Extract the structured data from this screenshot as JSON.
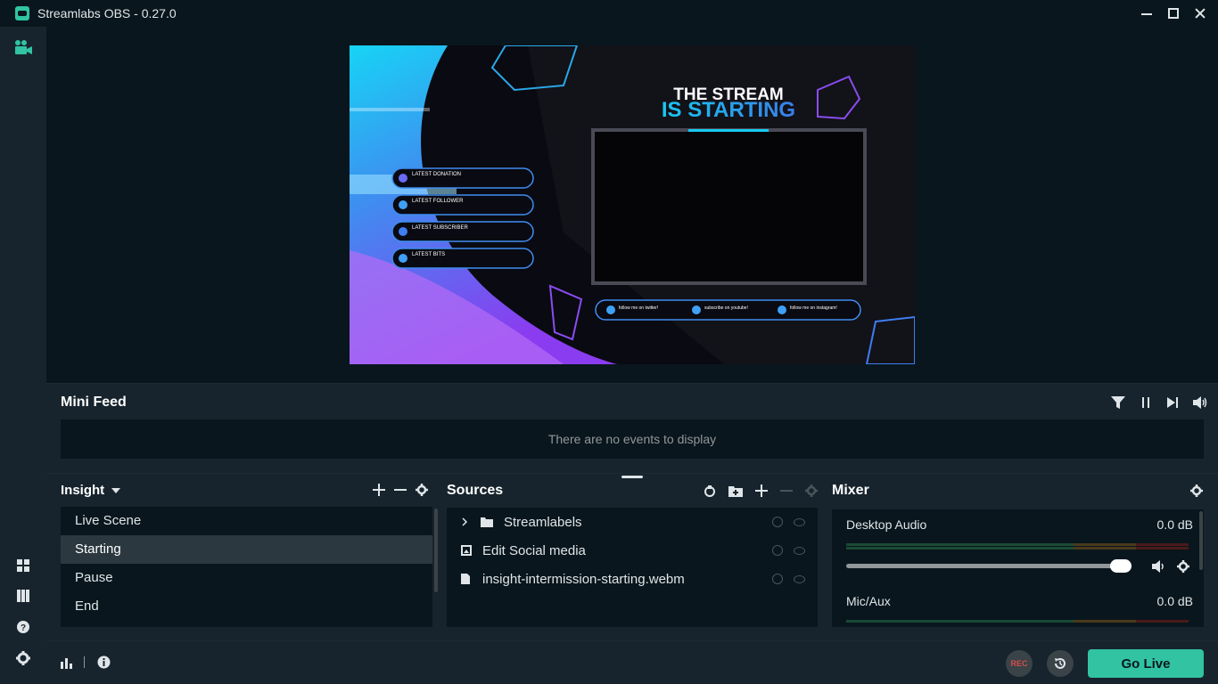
{
  "window": {
    "title": "Streamlabs OBS - 0.27.0"
  },
  "minifeed": {
    "title": "Mini Feed",
    "empty_text": "There are no events to display"
  },
  "scenes": {
    "collection": "Insight",
    "items": [
      "Live Scene",
      "Starting",
      "Pause",
      "End"
    ],
    "active": "Starting"
  },
  "sources": {
    "title": "Sources",
    "items": [
      {
        "name": "Streamlabels",
        "icon": "folder-icon",
        "expandable": true
      },
      {
        "name": "Edit Social media",
        "icon": "image-icon"
      },
      {
        "name": "insight-intermission-starting.webm",
        "icon": "file-icon"
      }
    ]
  },
  "mixer": {
    "title": "Mixer",
    "channels": [
      {
        "name": "Desktop Audio",
        "db": "0.0 dB",
        "volume": 1.0
      },
      {
        "name": "Mic/Aux",
        "db": "0.0 dB"
      }
    ]
  },
  "preview": {
    "heading_line1": "THE STREAM",
    "heading_line2": "IS STARTING",
    "labels": [
      "LATEST DONATION",
      "LATEST FOLLOWER",
      "LATEST SUBSCRIBER",
      "LATEST BITS"
    ],
    "socials": [
      "follow me on twitter!",
      "subscribe on youtube!",
      "follow me on instagram!"
    ]
  },
  "footer": {
    "rec_label": "REC",
    "go_live_label": "Go Live"
  },
  "colors": {
    "accent": "#31c3a2",
    "bg": "#09161d",
    "panel": "#17242d",
    "rec": "#d24e4e"
  }
}
